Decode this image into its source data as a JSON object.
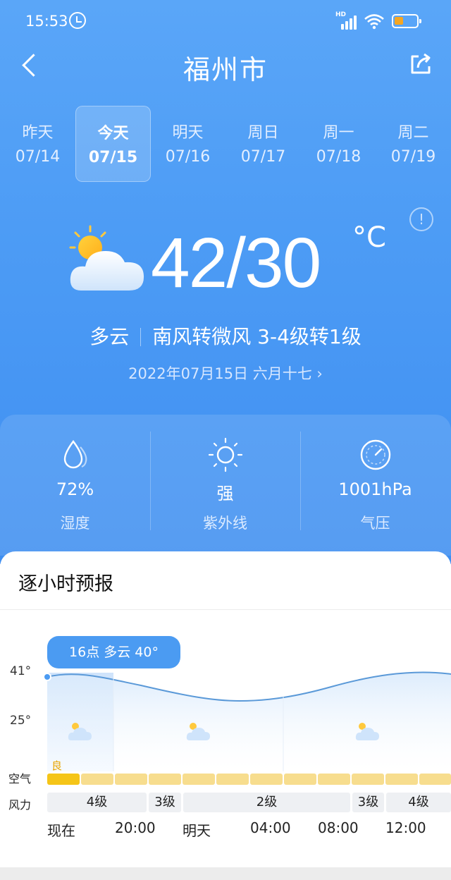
{
  "status": {
    "time": "15:53",
    "network": "HD"
  },
  "header": {
    "title": "福州市"
  },
  "days": [
    {
      "name": "昨天",
      "date": "07/14"
    },
    {
      "name": "今天",
      "date": "07/15"
    },
    {
      "name": "明天",
      "date": "07/16"
    },
    {
      "name": "周日",
      "date": "07/17"
    },
    {
      "name": "周一",
      "date": "07/18"
    },
    {
      "name": "周二",
      "date": "07/19"
    }
  ],
  "current": {
    "temp": "42/30",
    "unit": "°C",
    "condition": "多云",
    "wind": "南风转微风 3-4级转1级",
    "date": "2022年07月15日 六月十七 ›"
  },
  "stats": [
    {
      "value": "72%",
      "label": "湿度",
      "icon": "humidity-icon"
    },
    {
      "value": "强",
      "label": "紫外线",
      "icon": "sun-icon"
    },
    {
      "value": "1001hPa",
      "label": "气压",
      "icon": "pressure-icon"
    }
  ],
  "hourly": {
    "title": "逐小时预报",
    "tooltip": "16点 多云 40°",
    "y_labels": [
      "41°",
      "25°"
    ],
    "air_label": "空气",
    "air_quality": "良",
    "wind_label": "风力",
    "wind_levels": [
      "4级",
      "3级",
      "2级",
      "3级",
      "4级"
    ],
    "times": [
      "现在",
      "20:00",
      "明天",
      "04:00",
      "08:00",
      "12:00"
    ]
  },
  "colors": {
    "sky_top": "#5aa6f8",
    "sky_bottom": "#3f8ff1",
    "accent": "#4b9bf2",
    "air_good": "#f5c518"
  }
}
